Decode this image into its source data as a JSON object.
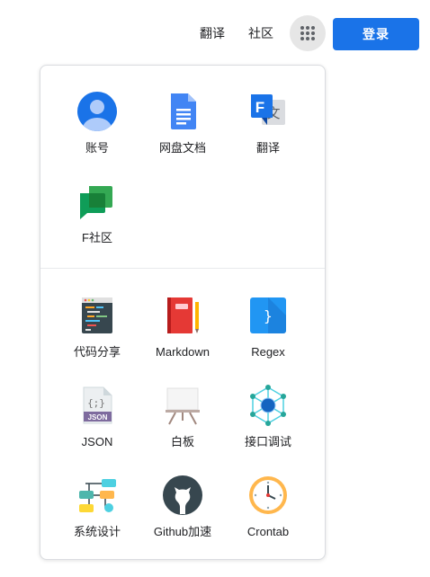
{
  "header": {
    "translate_link": "翻译",
    "community_link": "社区",
    "apps_icon": "grid-apps-icon",
    "login_label": "登录"
  },
  "colors": {
    "primary": "#1a73e8",
    "panel_border": "#dadce0",
    "apps_button_bg": "#e6e6e6"
  },
  "apps_section_1": [
    {
      "label": "账号",
      "icon": "account-icon"
    },
    {
      "label": "网盘文档",
      "icon": "docs-icon"
    },
    {
      "label": "翻译",
      "icon": "translate-icon"
    },
    {
      "label": "F社区",
      "icon": "chat-icon"
    }
  ],
  "apps_section_2": [
    {
      "label": "代码分享",
      "icon": "code-share-icon"
    },
    {
      "label": "Markdown",
      "icon": "markdown-notebook-icon"
    },
    {
      "label": "Regex",
      "icon": "regex-icon"
    },
    {
      "label": "JSON",
      "icon": "json-file-icon"
    },
    {
      "label": "白板",
      "icon": "whiteboard-icon"
    },
    {
      "label": "接口调试",
      "icon": "api-network-icon"
    },
    {
      "label": "系统设计",
      "icon": "flowchart-icon"
    },
    {
      "label": "Github加速",
      "icon": "github-icon"
    },
    {
      "label": "Crontab",
      "icon": "clock-icon"
    }
  ]
}
